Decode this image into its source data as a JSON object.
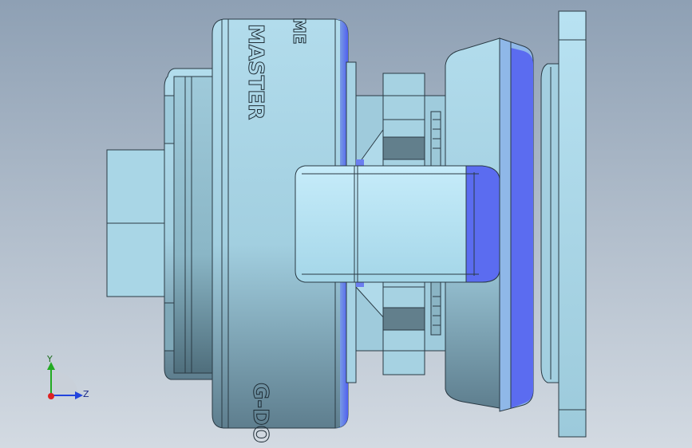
{
  "viewport": {
    "background_top": "#8ea0b4",
    "background_bottom": "#d3dae2"
  },
  "engraving": {
    "top_text_a": "MASTER",
    "top_text_b": "ME",
    "bottom_text": "G-DO"
  },
  "triad": {
    "x_label": "X",
    "y_label": "Y",
    "z_label": "Z",
    "y_color": "#22aa22",
    "z_color": "#2244dd",
    "x_color": "#dd2222"
  },
  "colors": {
    "part_light": "#b9e3f2",
    "part_mid": "#9ccde0",
    "part_dark": "#5f8898",
    "edge": "#2a3a44",
    "highlight_blue": "#5b6cf0"
  }
}
